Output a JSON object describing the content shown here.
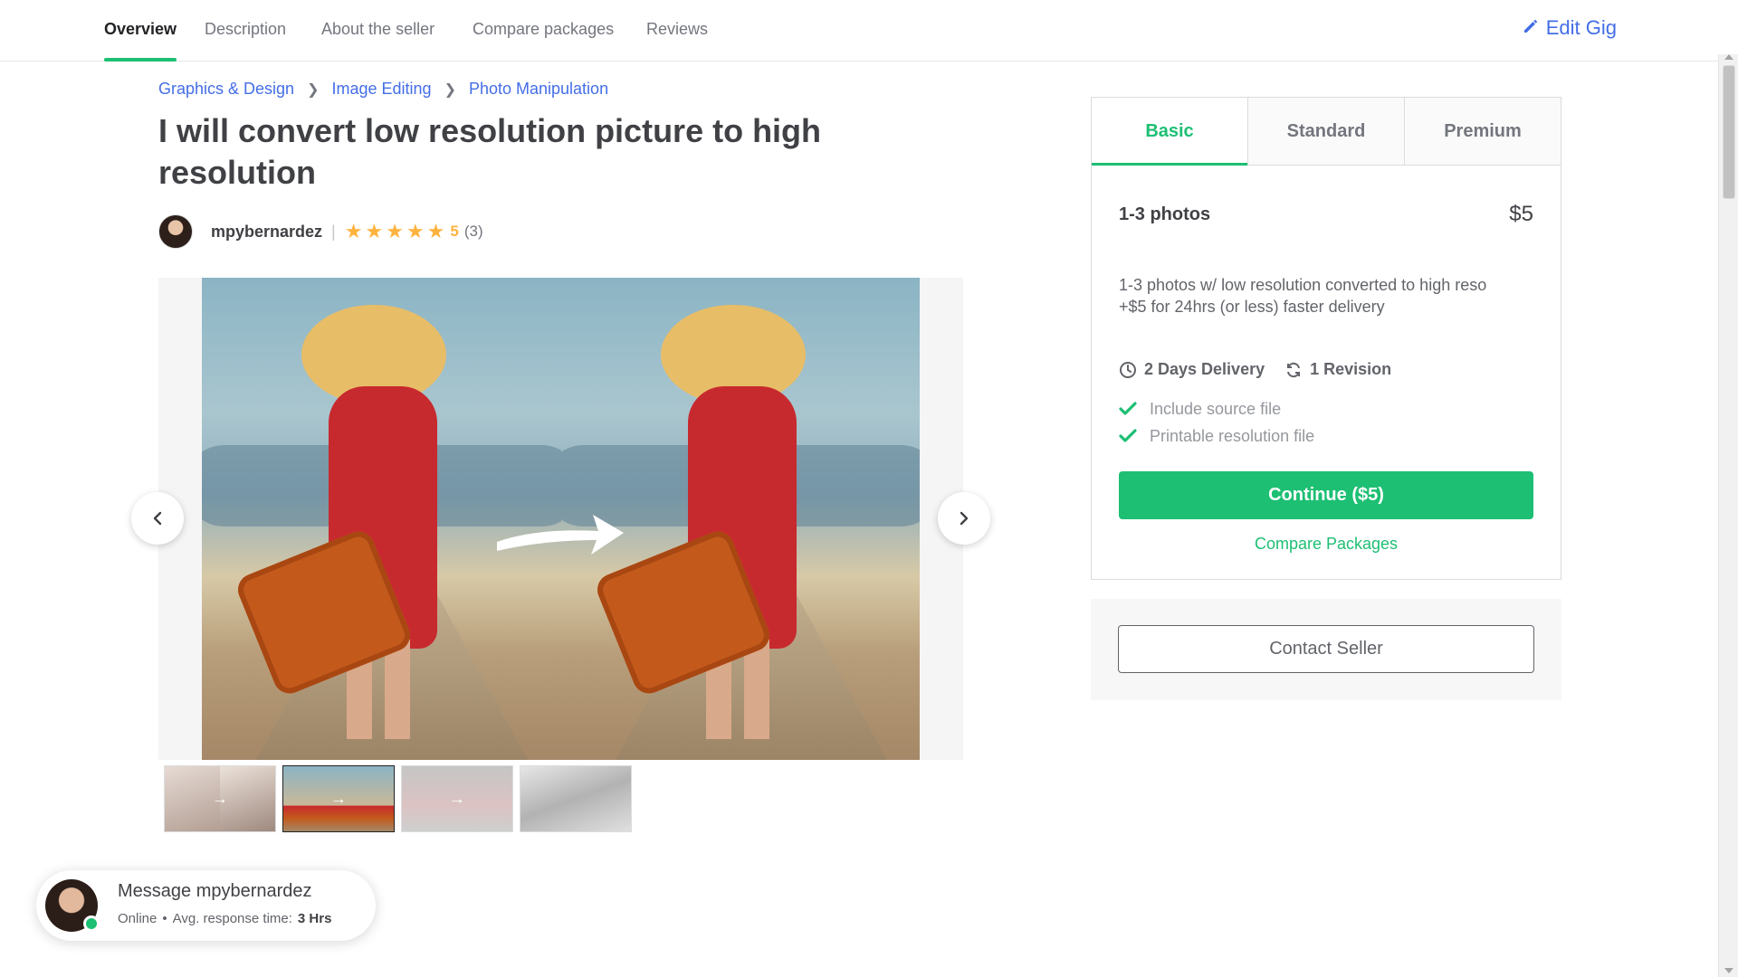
{
  "nav": {
    "tabs": [
      "Overview",
      "Description",
      "About the seller",
      "Compare packages",
      "Reviews"
    ],
    "edit_gig": "Edit Gig"
  },
  "breadcrumb": [
    "Graphics & Design",
    "Image Editing",
    "Photo Manipulation"
  ],
  "gig": {
    "title": "I will convert low resolution picture to high resolution",
    "seller": "mpybernardez",
    "rating": "5",
    "review_count": "(3)",
    "stars": 5
  },
  "gallery": {
    "thumbnail_count": 4,
    "selected_thumbnail": 2
  },
  "package": {
    "tabs": [
      "Basic",
      "Standard",
      "Premium"
    ],
    "active_tab": "Basic",
    "name": "1-3 photos",
    "price": "$5",
    "description_line1": "1-3 photos w/ low resolution converted to high reso",
    "description_line2": "+$5 for 24hrs (or less) faster delivery",
    "delivery": "2 Days Delivery",
    "revisions": "1 Revision",
    "features": [
      "Include source file",
      "Printable resolution file"
    ],
    "continue_label": "Continue ($5)",
    "compare_label": "Compare Packages"
  },
  "contact": {
    "label": "Contact Seller"
  },
  "message": {
    "title": "Message mpybernardez",
    "status": "Online",
    "response_label": "Avg. response time:",
    "response_value": "3 Hrs"
  },
  "colors": {
    "accent_green": "#1dbf73",
    "link_blue": "#446ee7",
    "star": "#ffb33e"
  }
}
